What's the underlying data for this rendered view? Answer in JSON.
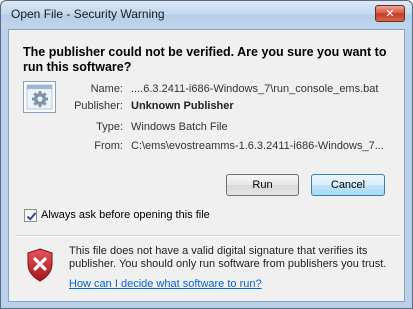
{
  "window": {
    "title": "Open File - Security Warning",
    "close_glyph": "✕"
  },
  "heading": "The publisher could not be verified.  Are you sure you want to run this software?",
  "file_icon": "batch-file-gear-icon",
  "fields": [
    {
      "label": "Name:",
      "value": "....6.3.2411-i686-Windows_7\\run_console_ems.bat"
    },
    {
      "label": "Publisher:",
      "value": "Unknown Publisher"
    },
    {
      "label": "Type:",
      "value": "Windows Batch File"
    },
    {
      "label": "From:",
      "value": "C:\\ems\\evostreamms-1.6.3.2411-i686-Windows_7..."
    }
  ],
  "buttons": {
    "run": "Run",
    "cancel": "Cancel"
  },
  "checkbox": {
    "label": "Always ask before opening this file",
    "checked": true
  },
  "warning": {
    "icon": "red-shield-x-icon",
    "text": "This file does not have a valid digital signature that verifies its publisher.  You should only run software from publishers you trust.",
    "link": "How can I decide what software to run?"
  },
  "colors": {
    "link": "#0066cc",
    "close_button": "#c33a20",
    "shield": "#c4262e",
    "default_button_border": "#3c7fb1"
  }
}
